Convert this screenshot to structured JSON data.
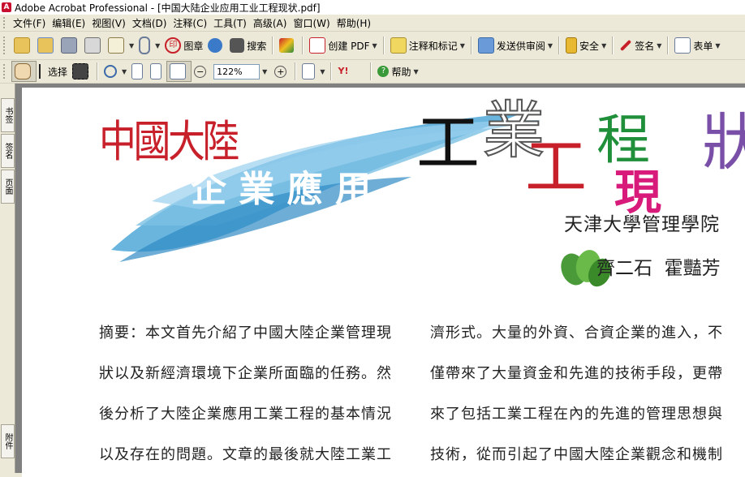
{
  "window": {
    "title": "Adobe Acrobat Professional - [中国大陆企业应用工业工程现状.pdf]",
    "app_icon_letter": "A"
  },
  "menubar": {
    "items": [
      "文件(F)",
      "编辑(E)",
      "视图(V)",
      "文档(D)",
      "注释(C)",
      "工具(T)",
      "高级(A)",
      "窗口(W)",
      "帮助(H)"
    ]
  },
  "toolbar1": {
    "stamp_label": "图章",
    "search_label": "搜索",
    "create_pdf_label": "创建 PDF",
    "comment_label": "注释和标记",
    "review_label": "发送供审阅",
    "security_label": "安全",
    "sign_label": "签名",
    "form_label": "表单"
  },
  "toolbar2": {
    "select_label": "选择",
    "zoom_value": "122%",
    "help_label": "帮助"
  },
  "navpanel": {
    "tabs": [
      "书签",
      "签名",
      "页面",
      "附件"
    ]
  },
  "document": {
    "title_mainland": "中國大陸",
    "title_apply": "企 業 應 用",
    "title_gong1": "工",
    "title_ye": "業",
    "title_gong2": "工",
    "title_cheng": "程",
    "title_xian": "現",
    "title_zhuang": "狀",
    "affiliation": "天津大學管理學院",
    "authors": "齊二石  霍豔芳",
    "body_col1": [
      "摘要：本文首先介紹了中國大陸企業管理現",
      "狀以及新經濟環境下企業所面臨的任務。然",
      "後分析了大陸企業應用工業工程的基本情況",
      "以及存在的問題。文章的最後就大陸工業工"
    ],
    "body_col2": [
      "濟形式。大量的外資、合資企業的進入，不",
      "僅帶來了大量資金和先進的技術手段，更帶",
      "來了包括工業工程在內的先進的管理思想與",
      "技術，從而引起了中國大陸企業觀念和機制"
    ]
  },
  "colors": {
    "title_red": "#c8202a",
    "swoosh_blue": "#4fa8d8",
    "cheng_green": "#1f8f3a",
    "xian_magenta": "#d81b7a",
    "zhuang_purple": "#7a4fa8"
  }
}
